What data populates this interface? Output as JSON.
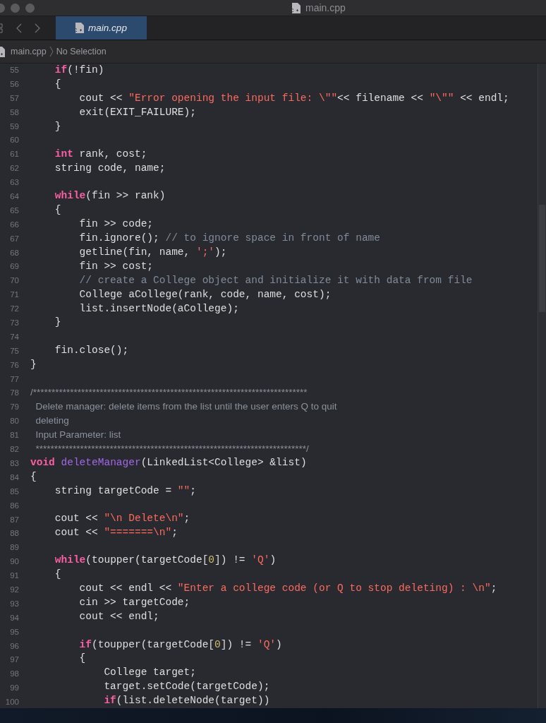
{
  "window": {
    "title": "main.cpp"
  },
  "tab": {
    "label": "main.cpp",
    "selected": true
  },
  "breadcrumb": [
    "main.cpp",
    "No Selection"
  ],
  "lines": [
    {
      "number": "55",
      "tokens": [
        {
          "kind": "keyword",
          "text": "    if"
        },
        {
          "kind": "plain",
          "text": "(!fin)"
        }
      ]
    },
    {
      "number": "56",
      "tokens": [
        {
          "kind": "plain",
          "text": "    {"
        }
      ]
    },
    {
      "number": "57",
      "tokens": [
        {
          "kind": "plain",
          "text": "        cout << "
        },
        {
          "kind": "string",
          "text": "\"Error opening the input file: \\\"\""
        },
        {
          "kind": "plain",
          "text": "<< filename << "
        },
        {
          "kind": "string",
          "text": "\"\\\"\""
        },
        {
          "kind": "plain",
          "text": " << endl;"
        }
      ]
    },
    {
      "number": "58",
      "tokens": [
        {
          "kind": "plain",
          "text": "        exit(EXIT_FAILURE);"
        }
      ]
    },
    {
      "number": "59",
      "tokens": [
        {
          "kind": "plain",
          "text": "    }"
        }
      ]
    },
    {
      "number": "60"
    },
    {
      "number": "61",
      "tokens": [
        {
          "kind": "keyword",
          "text": "    int"
        },
        {
          "kind": "plain",
          "text": " rank, cost;"
        }
      ]
    },
    {
      "number": "62",
      "tokens": [
        {
          "kind": "plain",
          "text": "    string code, name;"
        }
      ]
    },
    {
      "number": "63"
    },
    {
      "number": "64",
      "tokens": [
        {
          "kind": "keyword",
          "text": "    while"
        },
        {
          "kind": "plain",
          "text": "(fin >> rank)"
        }
      ]
    },
    {
      "number": "65",
      "tokens": [
        {
          "kind": "plain",
          "text": "    {"
        }
      ]
    },
    {
      "number": "66",
      "tokens": [
        {
          "kind": "plain",
          "text": "        fin >> code;"
        }
      ]
    },
    {
      "number": "67",
      "tokens": [
        {
          "kind": "plain",
          "text": "        fin.ignore(); "
        },
        {
          "kind": "comment",
          "text": "// to ignore space in front of name"
        }
      ]
    },
    {
      "number": "68",
      "tokens": [
        {
          "kind": "plain",
          "text": "        getline(fin, name, "
        },
        {
          "kind": "string",
          "text": "';'"
        },
        {
          "kind": "plain",
          "text": ");"
        }
      ]
    },
    {
      "number": "69",
      "tokens": [
        {
          "kind": "plain",
          "text": "        fin >> cost;"
        }
      ]
    },
    {
      "number": "70",
      "tokens": [
        {
          "kind": "comment",
          "text": "        // create a College object and initialize it with data from file"
        }
      ]
    },
    {
      "number": "71",
      "tokens": [
        {
          "kind": "plain",
          "text": "        College aCollege(rank, code, name, cost);"
        }
      ]
    },
    {
      "number": "72",
      "tokens": [
        {
          "kind": "plain",
          "text": "        list.insertNode(aCollege);"
        }
      ]
    },
    {
      "number": "73",
      "tokens": [
        {
          "kind": "plain",
          "text": "    }"
        }
      ]
    },
    {
      "number": "74"
    },
    {
      "number": "75",
      "tokens": [
        {
          "kind": "plain",
          "text": "    fin.close();"
        }
      ]
    },
    {
      "number": "76",
      "tokens": [
        {
          "kind": "plain",
          "text": "}"
        }
      ]
    },
    {
      "number": "77"
    },
    {
      "number": "78",
      "tokens": [
        {
          "kind": "doc",
          "text": "/**************************************************************************"
        }
      ]
    },
    {
      "number": "79",
      "tokens": [
        {
          "kind": "doc",
          "text": "  Delete manager: delete items from the list until the user enters Q to quit"
        }
      ]
    },
    {
      "number": "80",
      "tokens": [
        {
          "kind": "doc",
          "text": "  deleting"
        }
      ]
    },
    {
      "number": "81",
      "tokens": [
        {
          "kind": "doc",
          "text": "  Input Parameter: list"
        }
      ]
    },
    {
      "number": "82",
      "tokens": [
        {
          "kind": "doc",
          "text": "  *************************************************************************/"
        }
      ]
    },
    {
      "number": "83",
      "tokens": [
        {
          "kind": "keyword",
          "text": "void"
        },
        {
          "kind": "declaration",
          "text": " deleteManager"
        },
        {
          "kind": "plain",
          "text": "(LinkedList<College> &list)"
        }
      ]
    },
    {
      "number": "84",
      "tokens": [
        {
          "kind": "plain",
          "text": "{"
        }
      ]
    },
    {
      "number": "85",
      "tokens": [
        {
          "kind": "plain",
          "text": "    string targetCode = "
        },
        {
          "kind": "string",
          "text": "\"\""
        },
        {
          "kind": "plain",
          "text": ";"
        }
      ]
    },
    {
      "number": "86"
    },
    {
      "number": "87",
      "tokens": [
        {
          "kind": "plain",
          "text": "    cout << "
        },
        {
          "kind": "string",
          "text": "\"\\n Delete\\n\""
        },
        {
          "kind": "plain",
          "text": ";"
        }
      ]
    },
    {
      "number": "88",
      "tokens": [
        {
          "kind": "plain",
          "text": "    cout << "
        },
        {
          "kind": "string",
          "text": "\"=======\\n\""
        },
        {
          "kind": "plain",
          "text": ";"
        }
      ]
    },
    {
      "number": "89"
    },
    {
      "number": "90",
      "tokens": [
        {
          "kind": "keyword",
          "text": "    while"
        },
        {
          "kind": "plain",
          "text": "(toupper(targetCode["
        },
        {
          "kind": "number",
          "text": "0"
        },
        {
          "kind": "plain",
          "text": "]) != "
        },
        {
          "kind": "string",
          "text": "'Q'"
        },
        {
          "kind": "plain",
          "text": ")"
        }
      ]
    },
    {
      "number": "91",
      "tokens": [
        {
          "kind": "plain",
          "text": "    {"
        }
      ]
    },
    {
      "number": "92",
      "tokens": [
        {
          "kind": "plain",
          "text": "        cout << endl << "
        },
        {
          "kind": "string",
          "text": "\"Enter a college code (or Q to stop deleting) : \\n\""
        },
        {
          "kind": "plain",
          "text": ";"
        }
      ]
    },
    {
      "number": "93",
      "tokens": [
        {
          "kind": "plain",
          "text": "        cin >> targetCode;"
        }
      ]
    },
    {
      "number": "94",
      "tokens": [
        {
          "kind": "plain",
          "text": "        cout << endl;"
        }
      ]
    },
    {
      "number": "95"
    },
    {
      "number": "96",
      "tokens": [
        {
          "kind": "keyword",
          "text": "        if"
        },
        {
          "kind": "plain",
          "text": "(toupper(targetCode["
        },
        {
          "kind": "number",
          "text": "0"
        },
        {
          "kind": "plain",
          "text": "]) != "
        },
        {
          "kind": "string",
          "text": "'Q'"
        },
        {
          "kind": "plain",
          "text": ")"
        }
      ]
    },
    {
      "number": "97",
      "tokens": [
        {
          "kind": "plain",
          "text": "        {"
        }
      ]
    },
    {
      "number": "98",
      "tokens": [
        {
          "kind": "plain",
          "text": "            College target;"
        }
      ]
    },
    {
      "number": "99",
      "tokens": [
        {
          "kind": "plain",
          "text": "            target.setCode(targetCode);"
        }
      ]
    },
    {
      "number": "100",
      "tokens": [
        {
          "kind": "keyword",
          "text": "            if"
        },
        {
          "kind": "plain",
          "text": "(list.deleteNode(target))"
        }
      ]
    }
  ]
}
